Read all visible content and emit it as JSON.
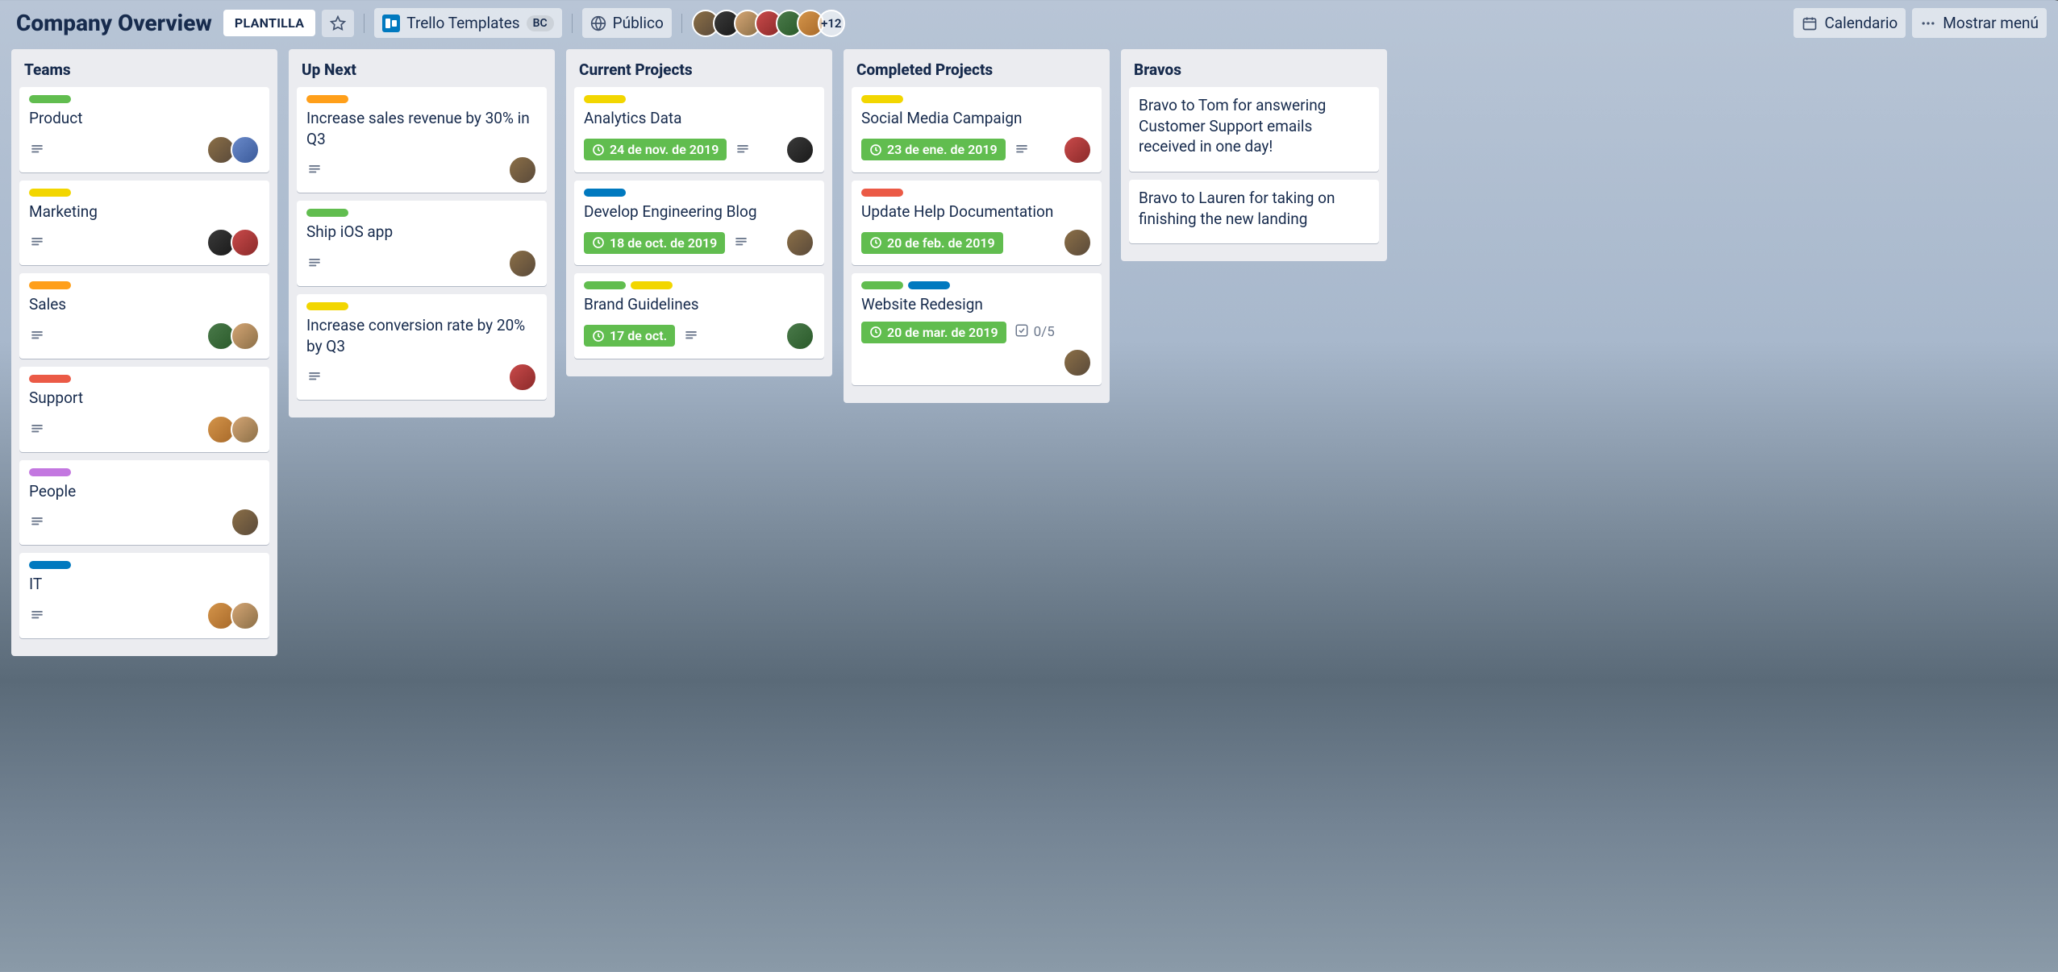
{
  "header": {
    "board_title": "Company Overview",
    "template_label": "PLANTILLA",
    "workspace_name": "Trello Templates",
    "workspace_badge": "BC",
    "visibility": "Público",
    "extra_members": "+12",
    "calendar": "Calendario",
    "show_menu": "Mostrar menú"
  },
  "lists": [
    {
      "title": "Teams",
      "cards": [
        {
          "title": "Product",
          "labels": [
            "green"
          ],
          "desc": true,
          "members": [
            "av1",
            "av7"
          ]
        },
        {
          "title": "Marketing",
          "labels": [
            "yellow"
          ],
          "desc": true,
          "members": [
            "av3",
            "av4"
          ]
        },
        {
          "title": "Sales",
          "labels": [
            "orange"
          ],
          "desc": true,
          "members": [
            "av5",
            "av2"
          ]
        },
        {
          "title": "Support",
          "labels": [
            "red"
          ],
          "desc": true,
          "members": [
            "av6",
            "av2"
          ]
        },
        {
          "title": "People",
          "labels": [
            "purple"
          ],
          "desc": true,
          "members": [
            "av1"
          ]
        },
        {
          "title": "IT",
          "labels": [
            "blue"
          ],
          "desc": true,
          "members": [
            "av6",
            "av2"
          ]
        }
      ]
    },
    {
      "title": "Up Next",
      "cards": [
        {
          "title": "Increase sales revenue by 30% in Q3",
          "labels": [
            "orange"
          ],
          "desc": true,
          "members": [
            "av1"
          ]
        },
        {
          "title": "Ship iOS app",
          "labels": [
            "green"
          ],
          "desc": true,
          "members": [
            "av1"
          ]
        },
        {
          "title": "Increase conversion rate by 20% by Q3",
          "labels": [
            "yellow"
          ],
          "desc": true,
          "members": [
            "av4"
          ]
        }
      ]
    },
    {
      "title": "Current Projects",
      "cards": [
        {
          "title": "Analytics Data",
          "labels": [
            "yellow"
          ],
          "due": "24 de nov. de 2019",
          "desc": true,
          "members": [
            "av3"
          ]
        },
        {
          "title": "Develop Engineering Blog",
          "labels": [
            "blue"
          ],
          "due": "18 de oct. de 2019",
          "desc": true,
          "members": [
            "av1"
          ]
        },
        {
          "title": "Brand Guidelines",
          "labels": [
            "green",
            "yellow"
          ],
          "due": "17 de oct.",
          "desc": true,
          "members": [
            "av5"
          ]
        }
      ]
    },
    {
      "title": "Completed Projects",
      "cards": [
        {
          "title": "Social Media Campaign",
          "labels": [
            "yellow"
          ],
          "due": "23 de ene. de 2019",
          "desc": true,
          "members": [
            "av4"
          ]
        },
        {
          "title": "Update Help Documentation",
          "labels": [
            "red"
          ],
          "due": "20 de feb. de 2019",
          "members": [
            "av1"
          ]
        },
        {
          "title": "Website Redesign",
          "labels": [
            "green",
            "blue"
          ],
          "due": "20 de mar. de 2019",
          "checklist": "0/5",
          "members": [
            "av1"
          ]
        }
      ]
    },
    {
      "title": "Bravos",
      "cards": [
        {
          "title": "Bravo to Tom for answering Customer Support emails received in one day!"
        },
        {
          "title": "Bravo to Lauren for taking on finishing the new landing"
        }
      ]
    }
  ]
}
